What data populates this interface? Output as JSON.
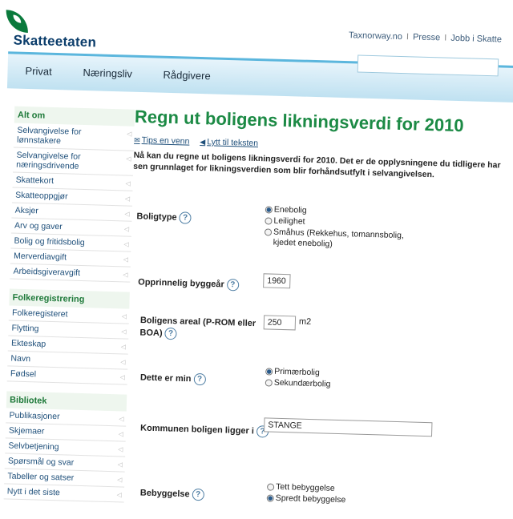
{
  "header": {
    "logo_text": "Skatteetaten",
    "top_links": [
      "Taxnorway.no",
      "Presse",
      "Jobb i Skatte"
    ],
    "separator": "I",
    "nav_tabs": [
      "Privat",
      "Næringsliv",
      "Rådgivere"
    ]
  },
  "sidebar": {
    "sections": [
      {
        "heading": "Alt om",
        "items": [
          "Selvangivelse for lønnstakere",
          "Selvangivelse for næringsdrivende",
          "Skattekort",
          "Skatteoppgjør",
          "Aksjer",
          "Arv og gaver",
          "Bolig og fritidsbolig",
          "Merverdiavgift",
          "Arbeidsgiveravgift"
        ]
      },
      {
        "heading": "Folkeregistrering",
        "items": [
          "Folkeregisteret",
          "Flytting",
          "Ekteskap",
          "Navn",
          "Fødsel"
        ]
      },
      {
        "heading": "Bibliotek",
        "items": [
          "Publikasjoner",
          "Skjemaer",
          "Selvbetjening",
          "Spørsmål og svar",
          "Tabeller og satser",
          "Nytt i det siste"
        ]
      }
    ]
  },
  "main": {
    "title": "Regn ut boligens likningsverdi for 2010",
    "tools": {
      "tips": "Tips en venn",
      "listen": "Lytt til teksten"
    },
    "intro": "Nå kan du regne ut boligens likningsverdi for 2010. Det er de opplysningene du tidligere har sen grunnlaget for likningsverdien som blir forhåndsutfylt i selvangivelsen.",
    "help_symbol": "?",
    "form": {
      "boligtype": {
        "label": "Boligtype",
        "options": [
          "Enebolig",
          "Leilighet",
          "Småhus (Rekkehus, tomannsbolig, kjedet enebolig)"
        ],
        "selected": 0
      },
      "byggeaar": {
        "label": "Opprinnelig byggeår",
        "value": "1960"
      },
      "areal": {
        "label": "Boligens areal (P-ROM eller BOA)",
        "value": "250",
        "unit": "m2"
      },
      "dette_er": {
        "label": "Dette er min",
        "options": [
          "Primærbolig",
          "Sekundærbolig"
        ],
        "selected": 0
      },
      "kommune": {
        "label": "Kommunen boligen ligger i",
        "value": "STANGE"
      },
      "bebyggelse": {
        "label": "Bebyggelse",
        "options": [
          "Tett bebyggelse",
          "Spredt bebyggelse"
        ],
        "selected": 1
      }
    }
  }
}
